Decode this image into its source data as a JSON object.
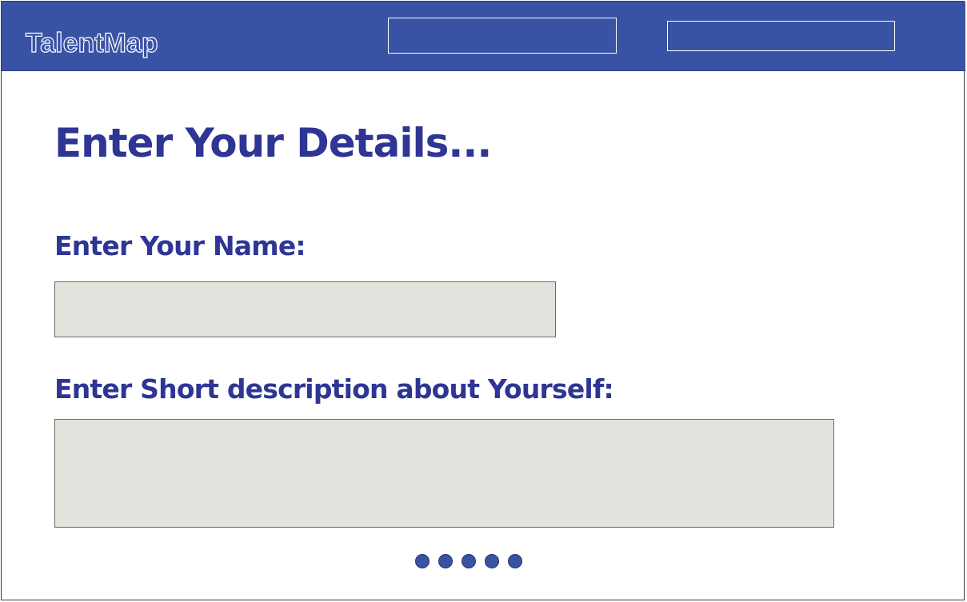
{
  "header": {
    "logo_text": "TalentMap",
    "nav_items": [
      "",
      ""
    ],
    "background_color": "#3953a4"
  },
  "main": {
    "title": "Enter Your Details...",
    "name_label": "Enter Your Name:",
    "name_value": "",
    "description_label": "Enter Short description about Yourself:",
    "description_value": "",
    "text_color": "#2e3594",
    "input_background": "#e3e3dd"
  },
  "pagination": {
    "dot_count": 5,
    "dot_color": "#3953a4"
  }
}
